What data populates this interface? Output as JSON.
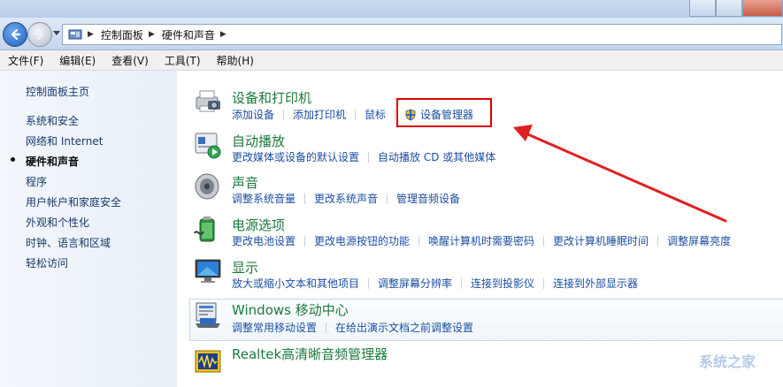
{
  "breadcrumb": [
    "控制面板",
    "硬件和声音"
  ],
  "menu": [
    "文件(F)",
    "编辑(E)",
    "查看(V)",
    "工具(T)",
    "帮助(H)"
  ],
  "sidebar": {
    "items": [
      {
        "label": "控制面板主页"
      },
      {
        "label": "系统和安全"
      },
      {
        "label": "网络和 Internet"
      },
      {
        "label": "硬件和声音",
        "current": true
      },
      {
        "label": "程序"
      },
      {
        "label": "用户帐户和家庭安全"
      },
      {
        "label": "外观和个性化"
      },
      {
        "label": "时钟、语言和区域"
      },
      {
        "label": "轻松访问"
      }
    ]
  },
  "categories": [
    {
      "title": "设备和打印机",
      "icon": "printer-camera-icon",
      "links": [
        "添加设备",
        "添加打印机",
        "鼠标",
        "设备管理器"
      ],
      "highlighted_link": "设备管理器",
      "highlight_color": "#e00000"
    },
    {
      "title": "自动播放",
      "icon": "autoplay-icon",
      "links": [
        "更改媒体或设备的默认设置",
        "自动播放 CD 或其他媒体"
      ]
    },
    {
      "title": "声音",
      "icon": "speaker-icon",
      "links": [
        "调整系统音量",
        "更改系统声音",
        "管理音频设备"
      ]
    },
    {
      "title": "电源选项",
      "icon": "battery-icon",
      "links": [
        "更改电池设置",
        "更改电源按钮的功能",
        "唤醒计算机时需要密码",
        "更改计算机睡眠时间",
        "调整屏幕亮度"
      ]
    },
    {
      "title": "显示",
      "icon": "monitor-icon",
      "links": [
        "放大或缩小文本和其他项目",
        "调整屏幕分辨率",
        "连接到投影仪",
        "连接到外部显示器"
      ]
    },
    {
      "title": "Windows 移动中心",
      "icon": "mobility-center-icon",
      "links": [
        "调整常用移动设置",
        "在给出演示文档之前调整设置"
      ]
    },
    {
      "title": "Realtek高清晰音频管理器",
      "icon": "realtek-audio-icon",
      "links": []
    }
  ],
  "annotation": {
    "color": "#e02020"
  },
  "colors": {
    "category_title": "#1b7a3a",
    "link": "#1a4ea3",
    "sidebar_link": "#173a6b"
  },
  "watermark": {
    "text": "系统之家"
  }
}
